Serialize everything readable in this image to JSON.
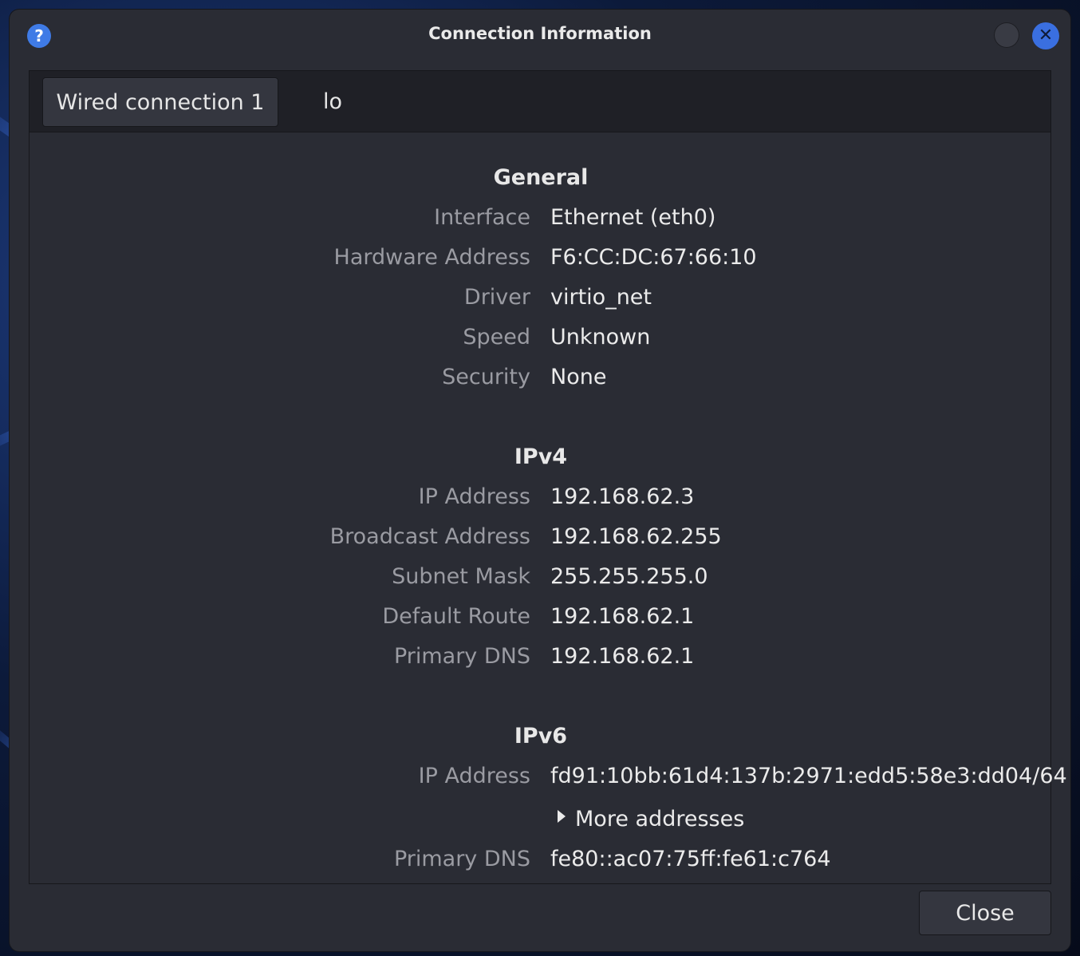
{
  "window": {
    "title": "Connection Information",
    "help_icon": "?",
    "close_icon": "✕"
  },
  "tabs": [
    {
      "label": "Wired connection 1",
      "active": true
    },
    {
      "label": "lo",
      "active": false
    }
  ],
  "general": {
    "title": "General",
    "rows": [
      {
        "label": "Interface",
        "value": "Ethernet (eth0)"
      },
      {
        "label": "Hardware Address",
        "value": "F6:CC:DC:67:66:10"
      },
      {
        "label": "Driver",
        "value": "virtio_net"
      },
      {
        "label": "Speed",
        "value": "Unknown"
      },
      {
        "label": "Security",
        "value": "None"
      }
    ]
  },
  "ipv4": {
    "title": "IPv4",
    "rows": [
      {
        "label": "IP Address",
        "value": "192.168.62.3"
      },
      {
        "label": "Broadcast Address",
        "value": "192.168.62.255"
      },
      {
        "label": "Subnet Mask",
        "value": "255.255.255.0"
      },
      {
        "label": "Default Route",
        "value": "192.168.62.1"
      },
      {
        "label": "Primary DNS",
        "value": "192.168.62.1"
      }
    ]
  },
  "ipv6": {
    "title": "IPv6",
    "ip_label": "IP Address",
    "ip_value": "fd91:10bb:61d4:137b:2971:edd5:58e3:dd04/64",
    "more_addresses": "More addresses",
    "dns_label": "Primary DNS",
    "dns_value": "fe80::ac07:75ff:fe61:c764"
  },
  "footer": {
    "close_label": "Close"
  },
  "colors": {
    "accent": "#3a6fe0",
    "window_bg": "#2a2c34",
    "label": "#9a9ba2",
    "value": "#ebebeb"
  }
}
